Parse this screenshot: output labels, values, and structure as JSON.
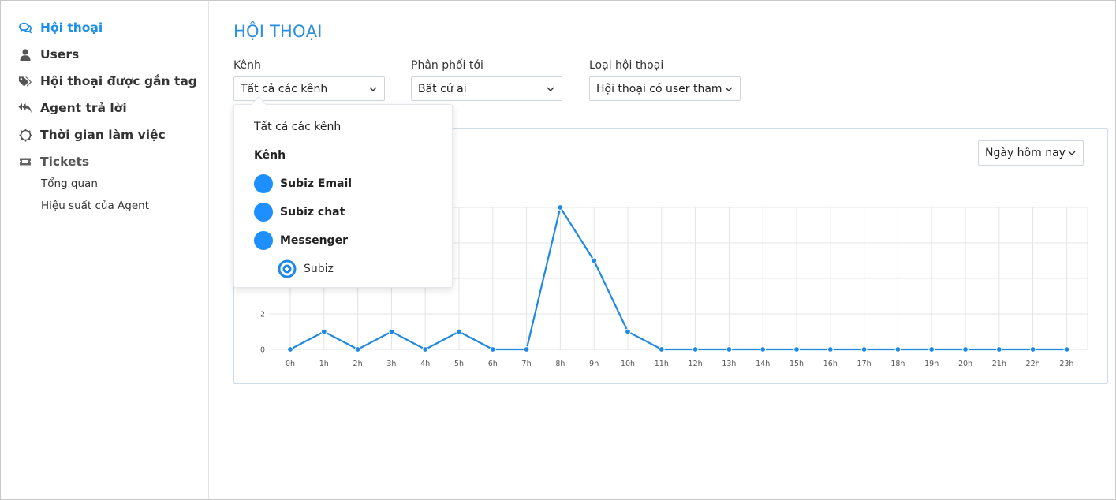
{
  "sidebar": {
    "items": [
      {
        "label": "Hội thoại",
        "icon": "chat-bubbles-icon",
        "active": true
      },
      {
        "label": "Users",
        "icon": "user-icon"
      },
      {
        "label": "Hội thoại được gắn tag",
        "icon": "tags-icon"
      },
      {
        "label": "Agent trả lời",
        "icon": "reply-all-icon"
      },
      {
        "label": "Thời gian làm việc",
        "icon": "clock-icon"
      }
    ],
    "section": {
      "label": "Tickets",
      "icon": "ticket-icon"
    },
    "sub_items": [
      {
        "label": "Tổng quan"
      },
      {
        "label": "Hiệu suất của Agent"
      }
    ]
  },
  "header": {
    "title": "HỘI THOẠI"
  },
  "filters": {
    "channel": {
      "label": "Kênh",
      "value": "Tất cả các kênh"
    },
    "assignee": {
      "label": "Phân phối tới",
      "value": "Bất cứ ai"
    },
    "type": {
      "label": "Loại hội thoại",
      "value": "Hội thoại có user tham ..."
    }
  },
  "range": {
    "value": "Ngày hôm nay"
  },
  "dropdown": {
    "all_option": "Tất cả các kênh",
    "group_label": "Kênh",
    "channels": [
      "Subiz Email",
      "Subiz chat",
      "Messenger"
    ],
    "sub_channel": "Subiz"
  },
  "colors": {
    "accent": "#1e8fe8",
    "line": "#1e88e5",
    "grid": "#e4e4e4"
  },
  "chart_data": {
    "type": "line",
    "categories": [
      "0h",
      "1h",
      "2h",
      "3h",
      "4h",
      "5h",
      "6h",
      "7h",
      "8h",
      "9h",
      "10h",
      "11h",
      "12h",
      "13h",
      "14h",
      "15h",
      "16h",
      "17h",
      "18h",
      "19h",
      "20h",
      "21h",
      "22h",
      "23h"
    ],
    "series": [
      {
        "values": [
          0,
          1,
          0,
          1,
          0,
          1,
          0,
          0,
          8,
          5,
          1,
          0,
          0,
          0,
          0,
          0,
          0,
          0,
          0,
          0,
          0,
          0,
          0,
          0
        ]
      }
    ],
    "y_ticks": [
      0,
      2
    ],
    "ylim": [
      0,
      8
    ],
    "grid": true
  }
}
